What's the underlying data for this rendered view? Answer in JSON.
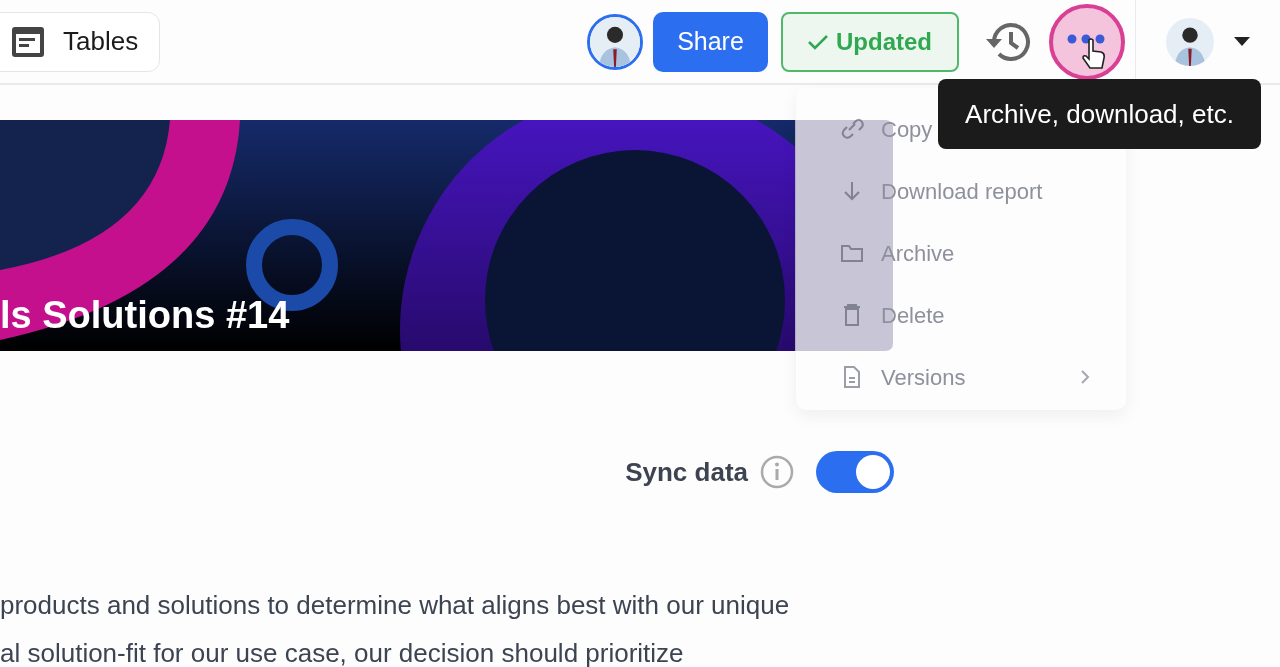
{
  "header": {
    "tables_button": "Tables",
    "share_button": "Share",
    "status_button": {
      "label": "Updated",
      "done": true
    },
    "more_button": {
      "tooltip": "Archive, download, etc."
    }
  },
  "banner": {
    "title": "ls Solutions #14"
  },
  "menu": {
    "items": [
      {
        "label": "Copy",
        "kind": "link"
      },
      {
        "label": "Download report",
        "kind": "download"
      },
      {
        "label": "Archive",
        "kind": "archive"
      },
      {
        "label": "Delete",
        "kind": "delete"
      },
      {
        "label": "Versions",
        "kind": "versions",
        "submenu": true
      }
    ]
  },
  "sync": {
    "label": "Sync data",
    "on": true
  },
  "body": {
    "lines": [
      "products and solutions to determine what aligns best with our unique",
      "al solution-fit for our use case, our decision should prioritize"
    ]
  }
}
